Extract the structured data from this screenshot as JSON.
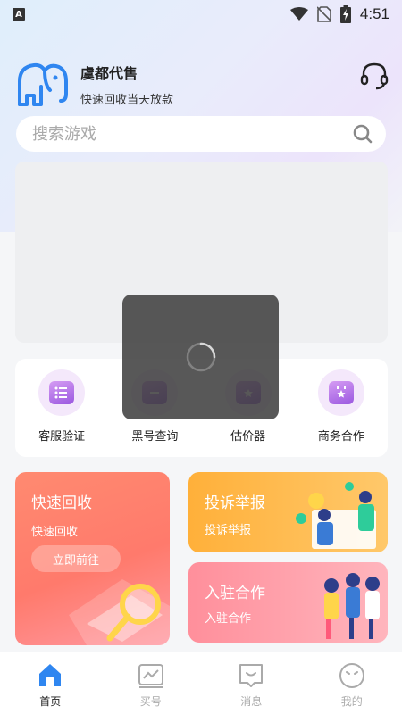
{
  "status_bar": {
    "time": "4:51",
    "indicator": "A"
  },
  "header": {
    "brand_name": "虞都代售",
    "slogan": "快速回收当天放款"
  },
  "search": {
    "placeholder": "搜索游戏"
  },
  "shortcuts": [
    {
      "label": "客服验证",
      "icon": "list-icon"
    },
    {
      "label": "黑号查询",
      "icon": "folder-icon"
    },
    {
      "label": "估价器",
      "icon": "shield-icon"
    },
    {
      "label": "商务合作",
      "icon": "calendar-star-icon"
    }
  ],
  "cards": {
    "quick_recycle": {
      "title": "快速回收",
      "subtitle": "快速回收",
      "button": "立即前往"
    },
    "complaint": {
      "title": "投诉举报",
      "subtitle": "投诉举报"
    },
    "join": {
      "title": "入驻合作",
      "subtitle": "入驻合作"
    }
  },
  "tabbar": [
    {
      "label": "首页",
      "icon": "home-icon",
      "active": true
    },
    {
      "label": "买号",
      "icon": "chart-icon",
      "active": false
    },
    {
      "label": "消息",
      "icon": "message-icon",
      "active": false
    },
    {
      "label": "我的",
      "icon": "profile-icon",
      "active": false
    }
  ],
  "colors": {
    "accent_blue": "#2f86f0",
    "card_orange": "#ff8a70",
    "card_yellow": "#ffb03a",
    "card_pink": "#ff8f9b",
    "shortcut_purple": "#b06ee8"
  }
}
